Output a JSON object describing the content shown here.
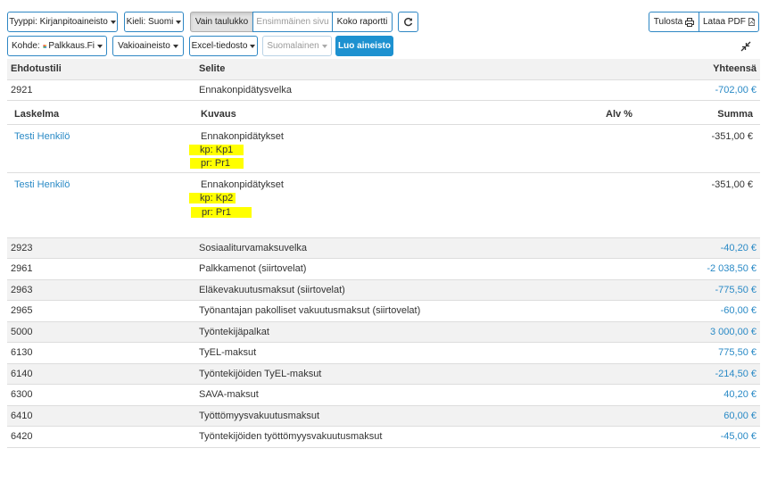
{
  "toolbar": {
    "type_label": "Tyyppi: Kirjanpitoaineisto",
    "language_label": "Kieli: Suomi",
    "view_table_only": "Vain taulukko",
    "view_first_page": "Ensimmäinen sivu",
    "view_full_report": "Koko raportti",
    "print_label": "Tulosta",
    "download_pdf_label": "Lataa PDF",
    "target_label": "Kohde:",
    "target_value": "Palkkaus.Fi",
    "standard_data_label": "Vakioaineisto",
    "excel_files_label": "Excel-tiedosto",
    "language_variant_label": "Suomalainen",
    "create_data_label": "Luo aineisto"
  },
  "table": {
    "headers": {
      "account": "Ehdotustili",
      "description": "Selite",
      "total": "Yhteensä"
    },
    "first_row": {
      "account": "2921",
      "description": "Ennakonpidätysvelka",
      "total": "-702,00 €"
    },
    "detail": {
      "headers": {
        "calculation": "Laskelma",
        "description": "Kuvaus",
        "vat": "Alv %",
        "sum": "Summa"
      },
      "rows": [
        {
          "calculation": "Testi Henkilö",
          "description": "Ennakonpidätykset",
          "kp": "kp: Kp1",
          "pr": "pr: Pr1",
          "sum": "-351,00 €"
        },
        {
          "calculation": "Testi Henkilö",
          "description": "Ennakonpidätykset",
          "kp": "kp: Kp2",
          "pr": "pr: Pr1",
          "sum": "-351,00 €"
        }
      ]
    },
    "rows": [
      {
        "account": "2923",
        "description": "Sosiaaliturvamaksuvelka",
        "total": "-40,20 €"
      },
      {
        "account": "2961",
        "description": "Palkkamenot (siirtovelat)",
        "total": "-2 038,50 €"
      },
      {
        "account": "2963",
        "description": "Eläkevakuutusmaksut (siirtovelat)",
        "total": "-775,50 €"
      },
      {
        "account": "2965",
        "description": "Työnantajan pakolliset vakuutusmaksut (siirtovelat)",
        "total": "-60,00 €"
      },
      {
        "account": "5000",
        "description": "Työntekijäpalkat",
        "total": "3 000,00 €"
      },
      {
        "account": "6130",
        "description": "TyEL-maksut",
        "total": "775,50 €"
      },
      {
        "account": "6140",
        "description": "Työntekijöiden TyEL-maksut",
        "total": "-214,50 €"
      },
      {
        "account": "6300",
        "description": "SAVA-maksut",
        "total": "40,20 €"
      },
      {
        "account": "6410",
        "description": "Työttömyysvakuutusmaksut",
        "total": "60,00 €"
      },
      {
        "account": "6420",
        "description": "Työntekijöiden työttömyysvakuutusmaksut",
        "total": "-45,00 €"
      }
    ]
  },
  "icons": {
    "refresh": "refresh-icon",
    "print": "printer-icon",
    "pdf": "pdf-file-icon",
    "collapse": "collapse-arrows-icon",
    "logo": "palkkaus-logo-icon"
  }
}
